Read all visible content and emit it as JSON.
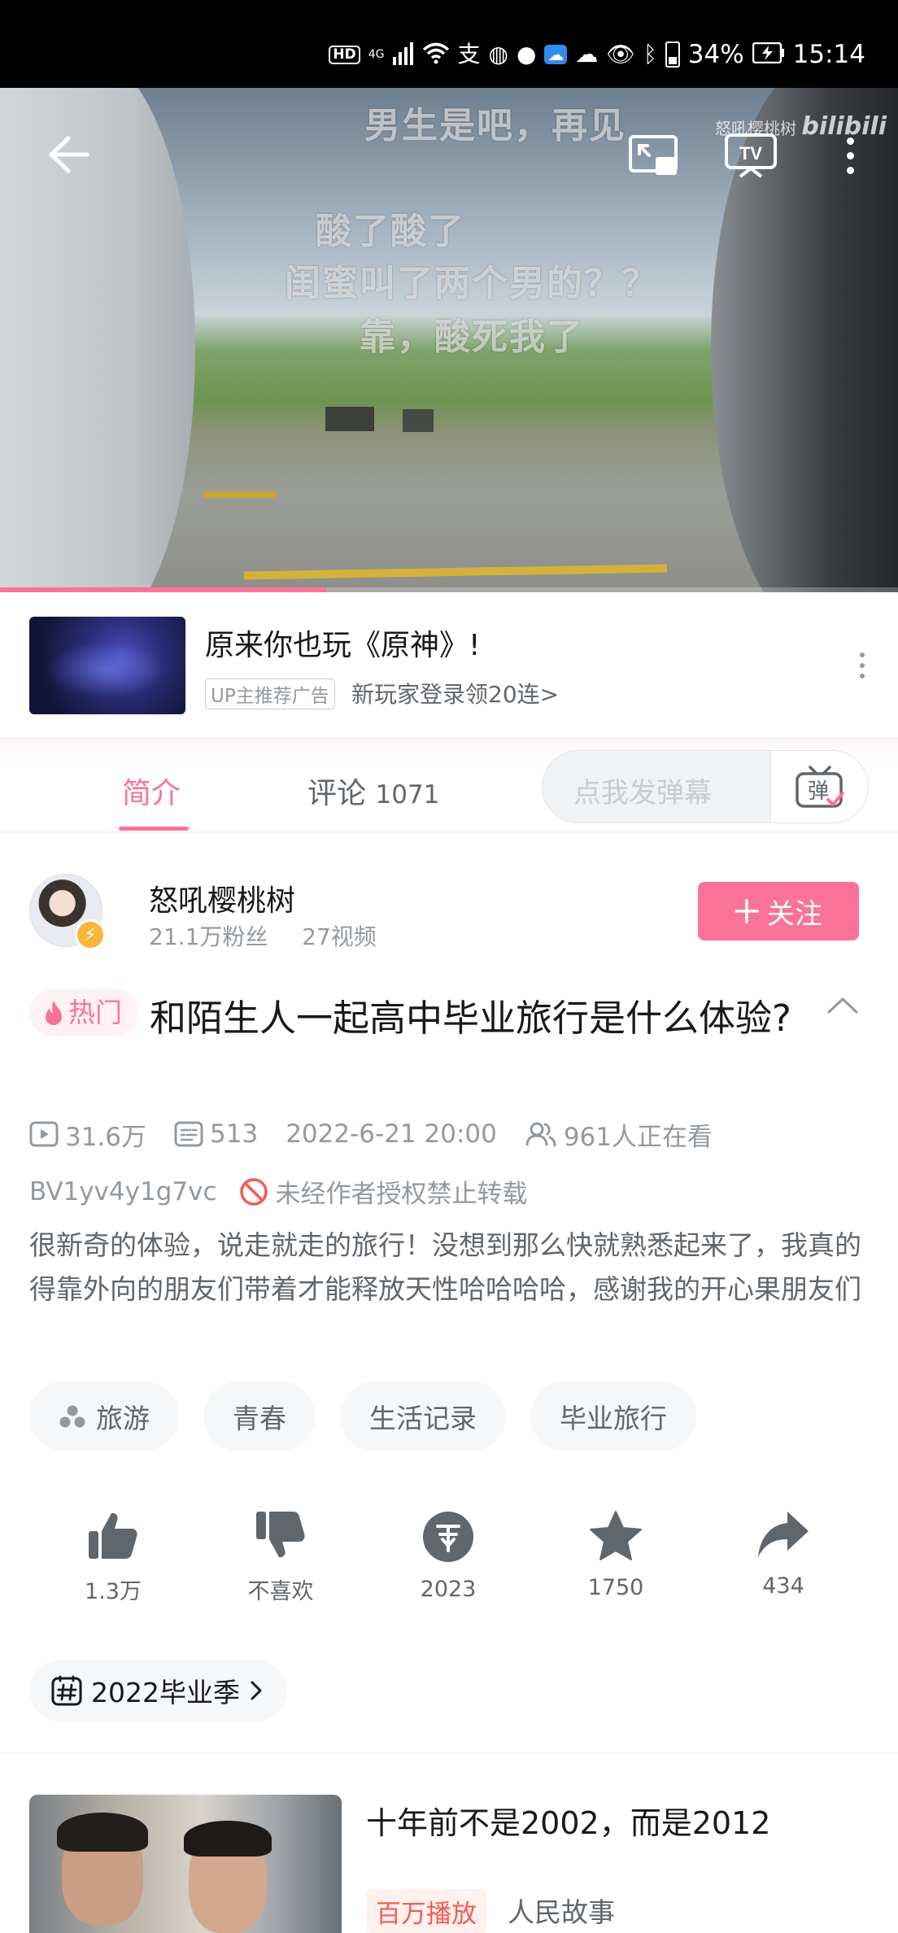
{
  "status_bar": {
    "network": "4G",
    "battery": "34%",
    "time": "15:14"
  },
  "video": {
    "danmaku": [
      "男生是吧，再见",
      "酸了酸了",
      "闺蜜叫了两个男的？？",
      "靠，酸死我了"
    ],
    "watermark": "怒吼樱桃树",
    "watermark_brand": "bilibili",
    "progress": 0.364
  },
  "ad": {
    "title": "原来你也玩《原神》!",
    "badge": "UP主推荐广告",
    "subtitle": "新玩家登录领20连>"
  },
  "tabs": {
    "intro": "简介",
    "comments": "评论",
    "comment_count": "1071",
    "danmaku_placeholder": "点我发弹幕",
    "danmaku_button": "弹"
  },
  "uploader": {
    "name": "怒吼樱桃树",
    "fans": "21.1万粉丝",
    "videos": "27视频",
    "follow_label": "关注"
  },
  "video_info": {
    "hot_label": "热门",
    "title": "和陌生人一起高中毕业旅行是什么体验?",
    "plays": "31.6万",
    "danmaku_count": "513",
    "date": "2022-6-21 20:00",
    "watching": "961人正在看",
    "bvid": "BV1yv4y1g7vc",
    "copyright": "未经作者授权禁止转载",
    "description": "很新奇的体验，说走就走的旅行！没想到那么快就熟悉起来了，我真的得靠外向的朋友们带着才能释放天性哈哈哈哈，感谢我的开心果朋友们"
  },
  "tags": [
    "旅游",
    "青春",
    "生活记录",
    "毕业旅行"
  ],
  "actions": {
    "like": "1.3万",
    "dislike": "不喜欢",
    "coin": "2023",
    "favorite": "1750",
    "share": "434"
  },
  "topic": "2022毕业季",
  "recommendation": {
    "title": "十年前不是2002，而是2012",
    "badge": "百万播放",
    "author": "人民故事"
  },
  "colors": {
    "accent": "#fb7299",
    "text_primary": "#18191c",
    "text_secondary": "#61666d",
    "text_muted": "#9499a0"
  }
}
